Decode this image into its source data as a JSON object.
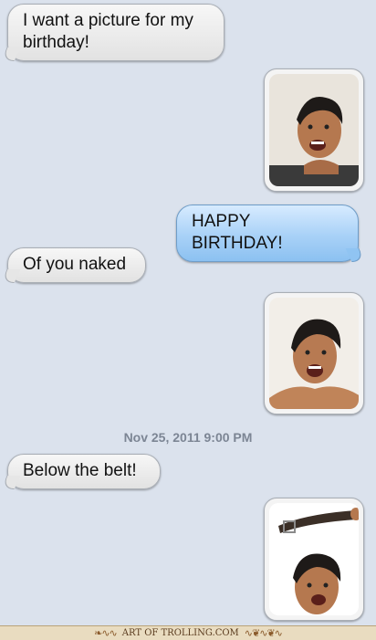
{
  "messages": [
    {
      "type": "text",
      "side": "in",
      "text": "I want a picture for my birthday!"
    },
    {
      "type": "photo",
      "side": "out",
      "icon": "selfie-photo-1"
    },
    {
      "type": "text",
      "side": "out",
      "text": "HAPPY BIRTHDAY!"
    },
    {
      "type": "text",
      "side": "in",
      "text": "Of you naked"
    },
    {
      "type": "photo",
      "side": "out",
      "icon": "selfie-photo-2"
    },
    {
      "type": "timestamp",
      "text": "Nov 25, 2011 9:00 PM"
    },
    {
      "type": "text",
      "side": "in",
      "text": "Below the belt!"
    },
    {
      "type": "photo",
      "side": "out",
      "icon": "selfie-photo-belt"
    }
  ],
  "footer": {
    "text": "ART OF TROLLING.COM"
  },
  "colors": {
    "background": "#dbe2ed",
    "incoming": "#ececec",
    "outgoing": "#a8d1f7"
  }
}
